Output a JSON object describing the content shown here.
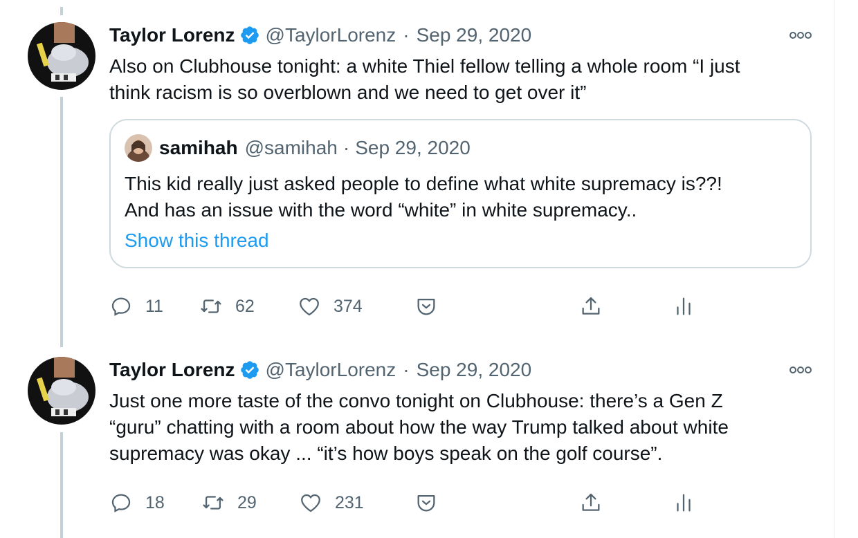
{
  "tweets": [
    {
      "author": "Taylor Lorenz",
      "handle": "@TaylorLorenz",
      "separator": "·",
      "date": "Sep 29, 2020",
      "text_lines": [
        "Also on Clubhouse tonight: a white Thiel fellow telling a whole room “I just",
        "think racism is so overblown and we need to get over it”"
      ],
      "quote": {
        "author": "samihah",
        "handle": "@samihah",
        "separator": "·",
        "date": "Sep 29, 2020",
        "text_lines": [
          "This kid really just asked people to define what white supremacy is??!",
          "And has an issue with the word “white” in white supremacy.."
        ],
        "link": "Show this thread"
      },
      "replies": "11",
      "retweets": "62",
      "likes": "374"
    },
    {
      "author": "Taylor Lorenz",
      "handle": "@TaylorLorenz",
      "separator": "·",
      "date": "Sep 29, 2020",
      "text_lines": [
        "Just one more taste of the convo tonight on Clubhouse: there’s a Gen Z",
        "“guru” chatting with a room about how the way Trump talked about white",
        "supremacy was okay ... “it’s how boys speak on the golf course”."
      ],
      "replies": "18",
      "retweets": "29",
      "likes": "231"
    }
  ],
  "colors": {
    "accent": "#1d9bf0",
    "muted": "#536471",
    "thread_line": "#c4cfd6",
    "border": "#cfd9de"
  },
  "icons": [
    "verified-badge-icon",
    "more-icon",
    "reply-icon",
    "retweet-icon",
    "like-icon",
    "tip-jar-icon",
    "share-icon",
    "analytics-icon"
  ]
}
